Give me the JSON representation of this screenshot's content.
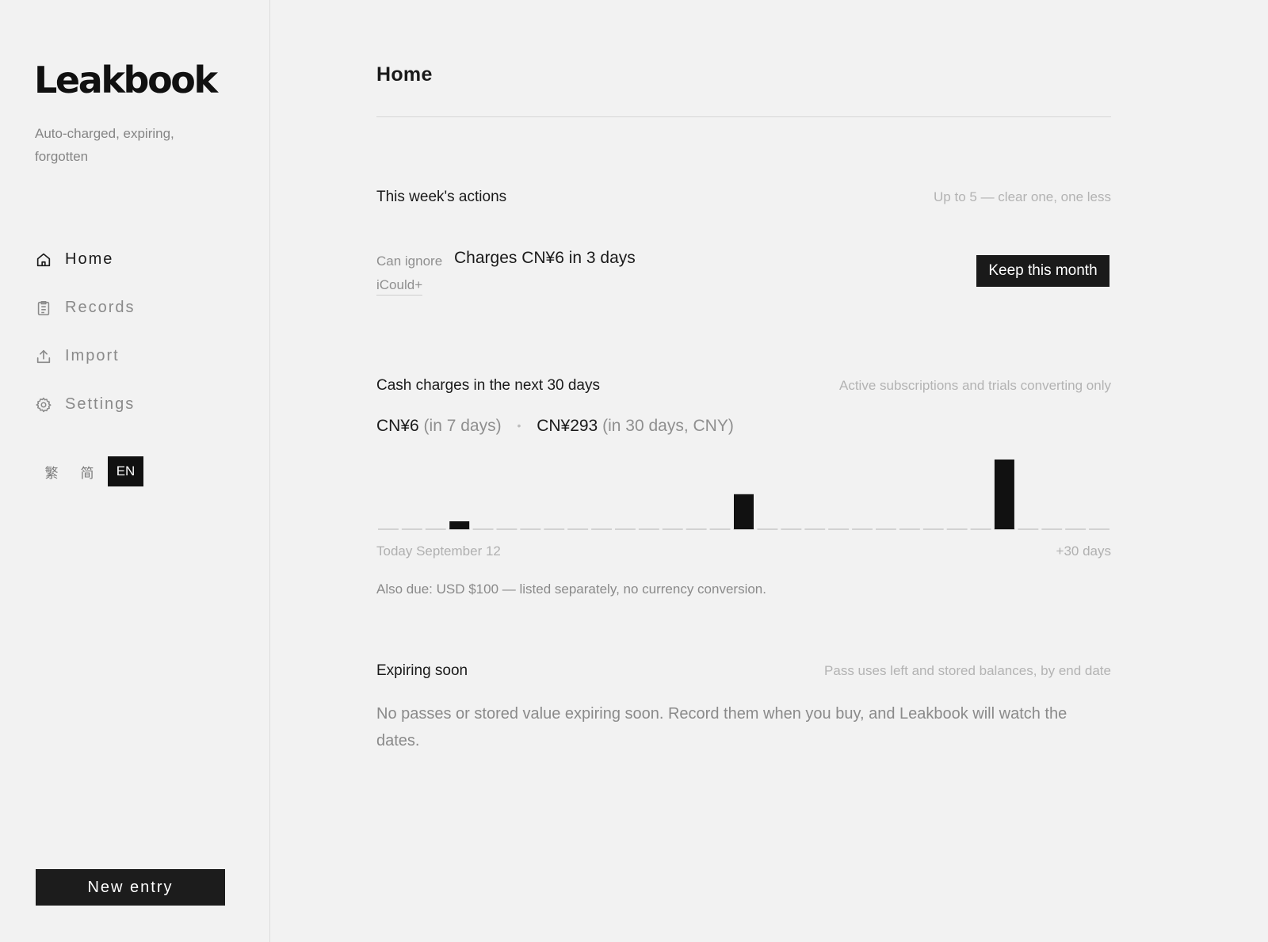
{
  "sidebar": {
    "logo": "Leakbook",
    "tagline": "Auto-charged, expiring, forgotten",
    "nav": [
      {
        "label": "Home",
        "icon": "home-icon",
        "active": true
      },
      {
        "label": "Records",
        "icon": "clipboard-icon",
        "active": false
      },
      {
        "label": "Import",
        "icon": "upload-icon",
        "active": false
      },
      {
        "label": "Settings",
        "icon": "gear-icon",
        "active": false
      }
    ],
    "languages": [
      {
        "label": "繁",
        "active": false
      },
      {
        "label": "简",
        "active": false
      },
      {
        "label": "EN",
        "active": true
      }
    ],
    "new_entry_label": "New entry"
  },
  "main": {
    "title": "Home",
    "actions": {
      "title": "This week's actions",
      "note": "Up to 5 — clear one, one less",
      "items": [
        {
          "tag": "Can ignore",
          "text": "Charges CN¥6 in 3 days",
          "sub": "iCould+",
          "button": "Keep this month"
        }
      ]
    },
    "charges": {
      "title": "Cash charges in the next 30 days",
      "note": "Active subscriptions and trials converting only",
      "total_7_amount": "CN¥6",
      "total_7_note": "(in 7 days)",
      "total_30_amount": "CN¥293",
      "total_30_note": "(in 30 days, CNY)",
      "axis_start": "Today September 12",
      "axis_end": "+30 days",
      "also_due": "Also due: USD $100 — listed separately, no currency conversion."
    },
    "expiring": {
      "title": "Expiring soon",
      "note": "Pass uses left and stored balances, by end date",
      "empty_text": "No passes or stored value expiring soon. Record them when you buy, and Leakbook will watch the dates."
    }
  },
  "chart_data": {
    "type": "bar",
    "x": [
      0,
      1,
      2,
      3,
      4,
      5,
      6,
      7,
      8,
      9,
      10,
      11,
      12,
      13,
      14,
      15,
      16,
      17,
      18,
      19,
      20,
      21,
      22,
      23,
      24,
      25,
      26,
      27,
      28,
      29,
      30
    ],
    "values": [
      0,
      0,
      0,
      6,
      0,
      0,
      0,
      0,
      0,
      0,
      0,
      0,
      0,
      0,
      0,
      0,
      0,
      0,
      0,
      0,
      0,
      0,
      0,
      0,
      0,
      0,
      0,
      0,
      0,
      0,
      0
    ],
    "values_note_omitted": true,
    "series": [
      {
        "values": [
          0,
          0,
          0,
          6,
          0,
          0,
          0,
          0,
          0,
          0,
          0,
          0,
          0,
          0,
          0,
          96,
          0,
          0,
          0,
          0,
          0,
          0,
          0,
          0,
          0,
          0,
          191,
          0,
          0,
          0,
          0
        ]
      }
    ],
    "colors": {
      "bar": "#111111",
      "baseline": "#d2d2d2"
    },
    "grid": false
  }
}
